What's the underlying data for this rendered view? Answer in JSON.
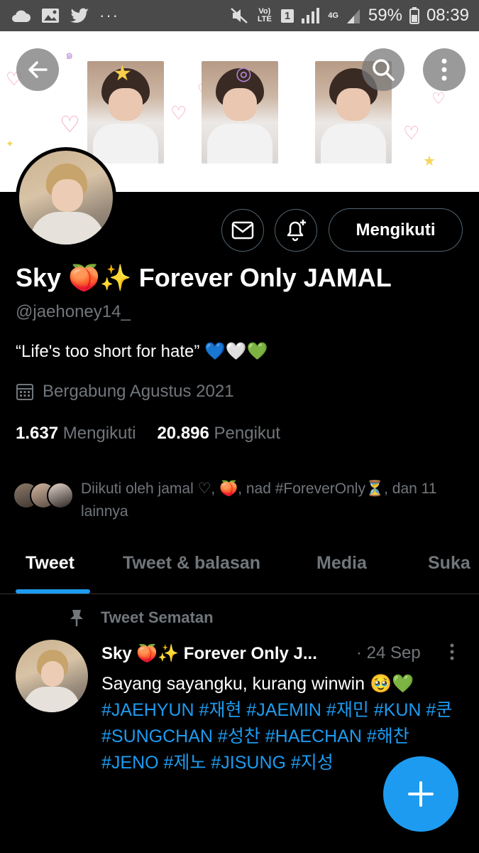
{
  "status_bar": {
    "carrier": "Vo) LTE",
    "sim": "1",
    "network": "4G",
    "battery": "59%",
    "time": "08:39",
    "more": "···"
  },
  "profile": {
    "display_name": "Sky 🍑✨ Forever Only JAMAL",
    "handle": "@jaehoney14_",
    "bio": "“Life's too short for hate” 💙🤍💚",
    "joined": "Bergabung Agustus 2021",
    "following_count": "1.637",
    "following_label": "Mengikuti",
    "followers_count": "20.896",
    "followers_label": "Pengikut",
    "followed_by": "Diikuti oleh jamal ♡, 🍑, nad #ForeverOnly⏳, dan 11 lainnya",
    "follow_button": "Mengikuti"
  },
  "tabs": [
    {
      "label": "Tweet"
    },
    {
      "label": "Tweet & balasan"
    },
    {
      "label": "Media"
    },
    {
      "label": "Suka"
    }
  ],
  "pinned_tweet": {
    "pinned_label": "Tweet Sematan",
    "author": "Sky 🍑✨ Forever Only J...",
    "date": "· 24 Sep",
    "text": "Sayang sayangku, kurang winwin 🥹💚",
    "hashtags": "#JAEHYUN #재현 #JAEMIN #재민 #KUN #쿤 #SUNGCHAN #성찬 #HAECHAN #해찬 #JENO #제노 #JISUNG #지성"
  },
  "colors": {
    "accent": "#1d9bf0",
    "background": "#000000",
    "muted": "#71767b"
  },
  "icons": [
    "cloud-icon",
    "image-icon",
    "twitter-bird-icon",
    "mute-icon",
    "signal-icon",
    "battery-icon",
    "back-arrow-icon",
    "search-icon",
    "more-vertical-icon",
    "mail-icon",
    "bell-plus-icon",
    "calendar-icon",
    "pin-icon",
    "plus-icon"
  ]
}
